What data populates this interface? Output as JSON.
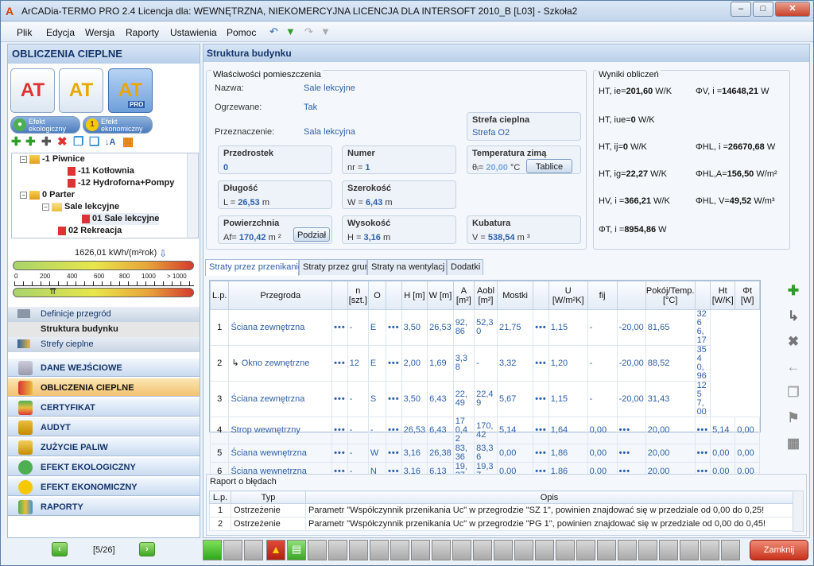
{
  "window": {
    "title": "ArCADia-TERMO PRO 2.4 Licencja dla: WEWNĘTRZNA, NIEKOMERCYJNA LICENCJA DLA INTERSOFT 2010_B [L03] - Szkoła2"
  },
  "menu": [
    "Plik",
    "Edycja",
    "Wersja",
    "Raporty",
    "Ustawienia",
    "Pomoc"
  ],
  "left": {
    "title": "OBLICZENIA CIEPLNE",
    "big_buttons": [
      "AT",
      "AT",
      "AT"
    ],
    "pro_badge": "PRO",
    "small_buttons": [
      "Efekt ekologiczny",
      "Efekt ekonomiczny"
    ],
    "tree": [
      {
        "label": "-1 Piwnice",
        "level": 1
      },
      {
        "label": "-11 Kotłownia",
        "level": 2
      },
      {
        "label": "-12 Hydroforna+Pompy",
        "level": 2
      },
      {
        "label": "0 Parter",
        "level": 1
      },
      {
        "label": "Sale lekcyjne",
        "level": 2
      },
      {
        "label": "01 Sale lekcyjne",
        "level": 3
      },
      {
        "label": "02 Rekreacja",
        "level": 2
      }
    ],
    "energy_value": "1626,01 kWh/(m²rok)",
    "energy_ticks": [
      "0",
      "200",
      "400",
      "600",
      "800",
      "1000",
      "> 1000"
    ],
    "sub_nav": [
      "Definicje przegród",
      "Struktura budynku",
      "Strefy cieplne"
    ],
    "nav": [
      "DANE WEJŚCIOWE",
      "OBLICZENIA CIEPLNE",
      "CERTYFIKAT",
      "AUDYT",
      "ZUŻYCIE PALIW",
      "EFEKT EKOLOGICZNY",
      "EFEKT EKONOMICZNY",
      "RAPORTY"
    ],
    "nav_selected": "OBLICZENIA CIEPLNE",
    "pager": "[5/26]"
  },
  "main": {
    "title": "Struktura budynku",
    "props": {
      "title": "Właściwości pomieszczenia",
      "nazwa_label": "Nazwa:",
      "nazwa": "Sale lekcyjne",
      "ogrzewane_label": "Ogrzewane:",
      "ogrzewane": "Tak",
      "przeznaczenie_label": "Przeznaczenie:",
      "przeznaczenie": "Sala lekcyjna",
      "strefa_title": "Strefa cieplna",
      "strefa": "Strefa O2",
      "przedrostek_title": "Przedrostek",
      "przedrostek": "0",
      "numer_title": "Numer",
      "numer_prefix": "nr =",
      "numer": "1",
      "temp_title": "Temperatura zimą",
      "temp_prefix": "θᵢ=",
      "temp": "20,00",
      "temp_unit": "°C",
      "tablice": "Tablice",
      "dlugosc_title": "Długość",
      "dlugosc_prefix": "L =",
      "dlugosc": "26,53",
      "dlugosc_unit": "m",
      "szerokosc_title": "Szerokość",
      "szerokosc_prefix": "W =",
      "szerokosc": "6,43",
      "szerokosc_unit": "m",
      "powierzchnia_title": "Powierzchnia",
      "powierzchnia_prefix": "Af=",
      "powierzchnia": "170,42",
      "powierzchnia_unit": "m ²",
      "podzial": "Podział",
      "wysokosc_title": "Wysokość",
      "wysokosc_prefix": "H =",
      "wysokosc": "3,16",
      "wysokosc_unit": "m",
      "kubatura_title": "Kubatura",
      "kubatura_prefix": "V =",
      "kubatura": "538,54",
      "kubatura_unit": "m ³"
    },
    "results": {
      "title": "Wyniki obliczeń",
      "items": [
        {
          "sym": "HT, ie=",
          "val": "201,60",
          "unit": "W/K"
        },
        {
          "sym": "ΦV, i =",
          "val": "14648,21",
          "unit": "W"
        },
        {
          "sym": "HT, iue=",
          "val": "0",
          "unit": "W/K"
        },
        {
          "sym": "HT, ij=",
          "val": "0",
          "unit": "W/K"
        },
        {
          "sym": "ΦHL, i =",
          "val": "26670,68",
          "unit": "W"
        },
        {
          "sym": "HT, ig=",
          "val": "22,27",
          "unit": "W/K"
        },
        {
          "sym": "ΦHL,A=",
          "val": "156,50",
          "unit": "W/m²"
        },
        {
          "sym": "HV, i =",
          "val": "366,21",
          "unit": "W/K"
        },
        {
          "sym": "ΦHL, V=",
          "val": "49,52",
          "unit": "W/m³"
        },
        {
          "sym": "ΦT, i =",
          "val": "8954,86",
          "unit": "W"
        }
      ]
    },
    "tabs": [
      "Straty przez przenikanie",
      "Straty przez grun",
      "Straty na wentylacj",
      "Dodatki"
    ],
    "tab_selected": "Straty przez przenikanie",
    "columns": [
      "L.p.",
      "Przegroda",
      "n [szt.]",
      "O",
      "H [m]",
      "W [m]",
      "A [m²]",
      "Aobl [m²]",
      "Mostki",
      "U [W/m²K]",
      "fij",
      "Pokój/Temp. [°C]",
      "Ht [W/K]",
      "Φt [W]"
    ],
    "rows": [
      [
        "1",
        "Ściana zewnętrzna",
        "-",
        "E",
        "3,50",
        "26,53",
        "92,86",
        "52,30",
        "21,75",
        "1,15",
        "-",
        "-20,00",
        "81,65",
        "3266,17"
      ],
      [
        "2",
        "Okno zewnętrzne",
        "12",
        "E",
        "2,00",
        "1,69",
        "3,38",
        "-",
        "3,32",
        "1,20",
        "-",
        "-20,00",
        "88,52",
        "3540,96"
      ],
      [
        "3",
        "Ściana zewnętrzna",
        "-",
        "S",
        "3,50",
        "6,43",
        "22,49",
        "22,49",
        "5,67",
        "1,15",
        "-",
        "-20,00",
        "31,43",
        "1257,00"
      ],
      [
        "4",
        "Strop wewnętrzny",
        "-",
        "-",
        "26,53",
        "6,43",
        "170,42",
        "170,42",
        "5,14",
        "1,64",
        "0,00",
        "20,00",
        "5,14",
        "0,00"
      ],
      [
        "5",
        "Ściana wewnętrzna",
        "-",
        "W",
        "3,16",
        "26,38",
        "83,36",
        "83,36",
        "0,00",
        "1,86",
        "0,00",
        "20,00",
        "0,00",
        "0,00"
      ],
      [
        "6",
        "Ściana wewnętrzna",
        "-",
        "N",
        "3,16",
        "6,13",
        "19,37",
        "19,37",
        "0,00",
        "1,86",
        "0,00",
        "20,00",
        "0,00",
        "0,00"
      ]
    ],
    "errors": {
      "title": "Raport o błędach",
      "columns": [
        "L.p.",
        "Typ",
        "Opis"
      ],
      "rows": [
        [
          "1",
          "Ostrzeżenie",
          "Parametr \"Współczynnik przenikania Uc\" w przegrodzie \"SZ 1\", powinien znajdować się w przedziale od 0,00 do 0,25!"
        ],
        [
          "2",
          "Ostrzeżenie",
          "Parametr \"Współczynnik przenikania Uc\" w przegrodzie \"PG 1\", powinien znajdować się w przedziale od 0,00 do 0,45!"
        ]
      ]
    }
  },
  "close_button": "Zamknij",
  "colors": {
    "accent_blue": "#2d5fa8",
    "nav_selected": "#f2c270",
    "close_red": "#c8321c"
  }
}
